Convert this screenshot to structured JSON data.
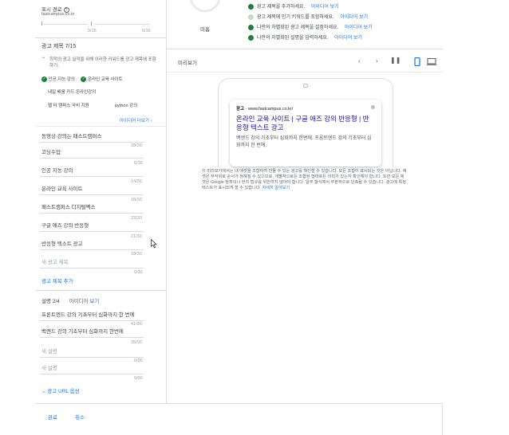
{
  "display_path": {
    "label": "표시 경로",
    "domain": "fastcampus.co.kr",
    "path1_count": "0/15",
    "path2_count": "0/15"
  },
  "headlines": {
    "heading": "광고 제목 7/15",
    "tip_text": "최적의 광고 실적을 위해 이러한 키워드를 광고 제목에 포함하기:",
    "keywords_done": [
      "인공 지능 강의",
      "온라인 교육 사이트"
    ],
    "keywords_more": [
      "내일 배움 카드 온라인강의",
      "웹 터 캠퍼스 국비 지원",
      "python 강의"
    ],
    "more_ideas": "아이디어 더보기",
    "top_input": "동영상 강의는 패스트캠퍼스",
    "items": [
      {
        "text": "코딩수업",
        "count": "28/30"
      },
      {
        "text": "인공 지능 강의",
        "count": "6/30"
      },
      {
        "text": "온라인 교육 사이트",
        "count": "14/30"
      },
      {
        "text": "패스트캠퍼스 디지털멕스",
        "count": "18/30"
      },
      {
        "text": "구글 애즈 강의 반응형",
        "count": "23/30"
      },
      {
        "text": "반응형 텍스트 광고",
        "count": "21/30"
      },
      {
        "text": "새 광고 제목",
        "count": "18/30"
      }
    ],
    "last_count": "0/30",
    "add_link": "광고 제목 추가"
  },
  "descriptions": {
    "heading": "설명 2/4",
    "ideas_link": "아이디어 보기",
    "items": [
      {
        "text": "프론트엔드 강의 기초부터 심화까지 한 번에",
        "count": "41/90",
        "placeholder": false
      },
      {
        "text": "백엔드 강의 기초부터 심화까지 한번에",
        "count": "39/90",
        "placeholder": false
      },
      {
        "text": "새 설명",
        "count": "0/90",
        "placeholder": true
      },
      {
        "text": "새 설명",
        "count": "0/90",
        "placeholder": true
      }
    ],
    "url_options": "광고 URL 옵션"
  },
  "strength": {
    "label": "미흡",
    "tips": [
      {
        "text": "광고 제목을 추가하세요.",
        "link": "아이디어 보기",
        "color": "#188038"
      },
      {
        "text": "광고 제목에 인기 키워드를 포함하세요.",
        "link": "아이디어 보기",
        "color": "#c6dacb"
      },
      {
        "text": "나만의 차별화된 광고 제목을 설정하세요.",
        "link": "아이디어 보기",
        "color": "#188038"
      },
      {
        "text": "나만의 차별화된 설명을 입력하세요.",
        "link": "아이디어 보기",
        "color": "#188038"
      }
    ]
  },
  "preview": {
    "title": "미리보기",
    "ad_badge": "광고",
    "ad_url": "www.fastcampus.co.kr/",
    "ad_headline": "온라인 교육 사이트 | 구글 애즈 강의 반응형 | 반응형 텍스트 광고",
    "ad_description": "백엔드 강의 기초부터 심화까지 한번에. 프론트엔드 강의 기초부터 심화까지 한 번에.",
    "notice": "이 미리보기에서는 내 애셋을 조합하여 만들 수 있는 광고를 확인할 수 있습니다. 모든 조합이 표시되는 것은 아닙니다. 애셋은 무작위로 순서가 정해질 수 있으므로, 개별적으로든 조합된 형태로든 의미가 있는지 확인해야 합니다. 또한 모든 애셋은 Google 정책이나 현지 법규를 위반하지 않아야 합니다. 일부 형식에서 부분적으로 단축될 수 있습니다. 광고에 특정 텍스트가 표시되게 할 수 있습니다.",
    "learn_more": "자세히 알아보기"
  },
  "footer": {
    "done": "완료",
    "cancel": "취소"
  },
  "colors": {
    "accent": "#1a73e8",
    "success": "#188038"
  }
}
